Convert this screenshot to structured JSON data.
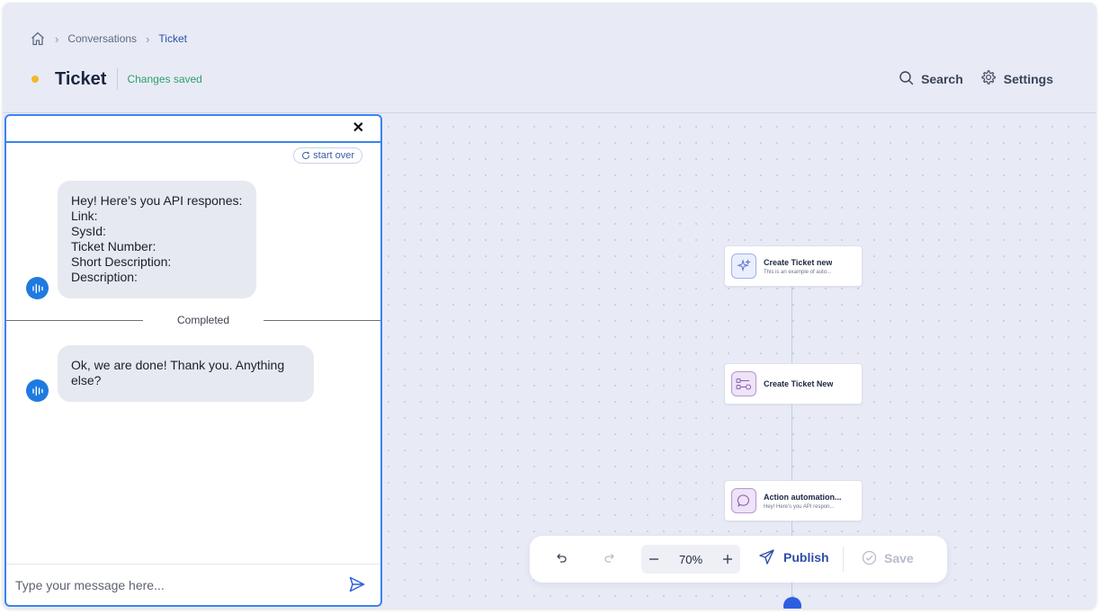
{
  "breadcrumb": {
    "home_icon": "home-icon",
    "items": [
      "Conversations",
      "Ticket"
    ]
  },
  "header": {
    "title": "Ticket",
    "status": "Changes saved",
    "status_color": "#2e9e6b",
    "dot_color": "#f2b72a",
    "search_label": "Search",
    "settings_label": "Settings"
  },
  "flow": {
    "nodes": [
      {
        "title": "Create Ticket new",
        "subtitle": "This is an example of auto...",
        "icon": "sparkle-icon"
      },
      {
        "title": "Create Ticket New",
        "subtitle": "",
        "icon": "flow-icon"
      },
      {
        "title": "Action automation...",
        "subtitle": "Hey! Here's you API respon...",
        "icon": "chat-bubble-icon"
      }
    ]
  },
  "toolbar": {
    "zoom": "70%",
    "publish_label": "Publish",
    "save_label": "Save"
  },
  "chat": {
    "start_over_label": "start over",
    "messages": [
      {
        "lines": [
          "Hey! Here’s you API respones:",
          "Link:",
          "SysId:",
          "Ticket Number:",
          "Short Description:",
          "Description:"
        ]
      },
      {
        "lines": [
          "Ok, we are done! Thank you. Anything",
          "else?"
        ]
      }
    ],
    "divider_label": "Completed",
    "input_placeholder": "Type your message here..."
  },
  "colors": {
    "accent": "#2c4fa8",
    "chat_border": "#3c83f0",
    "bot_avatar": "#1f7ae0"
  }
}
